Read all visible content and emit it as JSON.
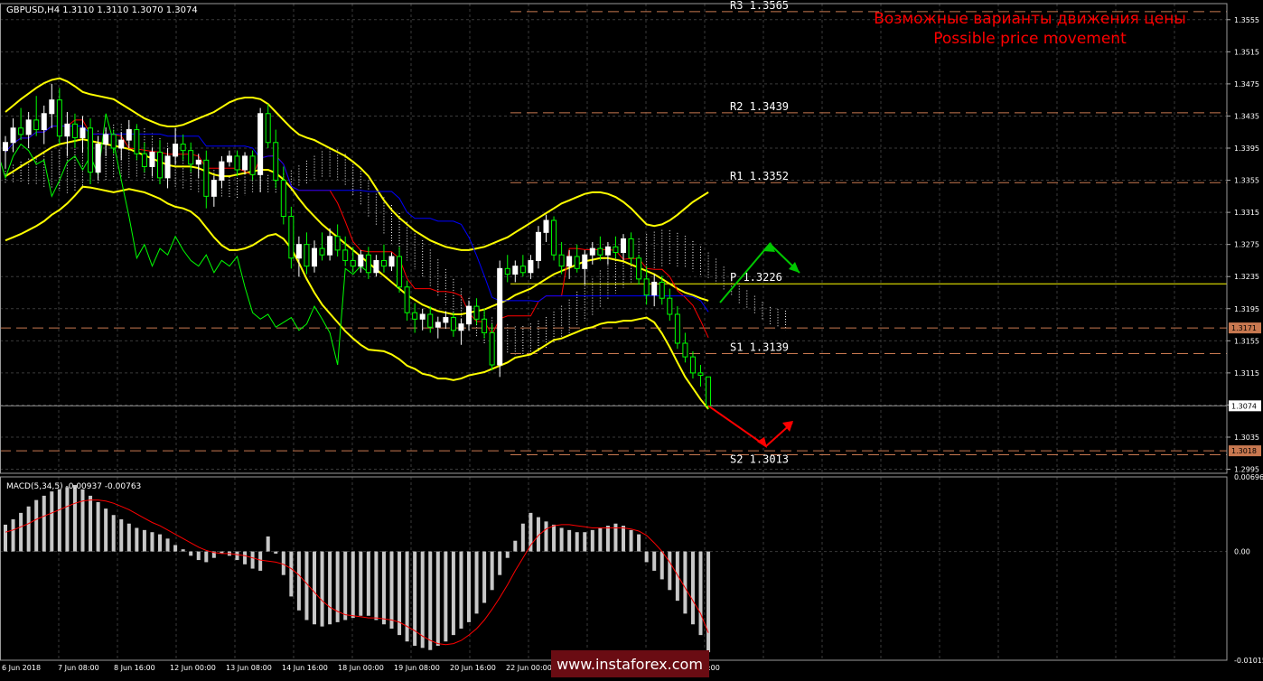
{
  "header": {
    "symbol_line": "GBPUSD,H4  1.3110 1.3110 1.3070 1.3074",
    "title_ru": "Возможные варианты движения цены",
    "title_en": "Possible price movement"
  },
  "macd_header": "MACD(5,34,5) -0.00937 -0.00763",
  "watermark": "www.instaforex.com",
  "colors": {
    "background": "#000000",
    "grid": "#3a3a3a",
    "candle_up": "#ffffff",
    "candle_down": "#00ff00",
    "bollinger": "#ffff00",
    "tenkan": "#ff0000",
    "kijun": "#0000ff",
    "chikou": "#00ff00",
    "kumo_bull": "#ffffff",
    "kumo_bear": "#ff9977",
    "pivot_level": "#c87850",
    "pivot_line": "#ffff00",
    "macd_hist": "#c8c8c8",
    "macd_signal": "#ff0000",
    "title_text": "#ff0000",
    "arrow_up": "#00c800",
    "arrow_down": "#ff0000"
  },
  "chart_data": [
    {
      "type": "candlestick",
      "x_labels": [
        "6 Jun 2018",
        "7 Jun 08:00",
        "8 Jun 16:00",
        "12 Jun 00:00",
        "13 Jun 08:00",
        "14 Jun 16:00",
        "18 Jun 00:00",
        "19 Jun 08:00",
        "20 Jun 16:00",
        "22 Jun 00:00",
        "25 Jun 08:00",
        "26 Jun 16:00",
        "28 Jun 00:00"
      ],
      "y_ticks": [
        "1.3555",
        "1.3515",
        "1.3475",
        "1.3435",
        "1.3395",
        "1.3355",
        "1.3315",
        "1.3275",
        "1.3235",
        "1.3195",
        "1.3155",
        "1.3115",
        "1.3075",
        "1.3035",
        "1.2995"
      ],
      "ylim": [
        1.299,
        1.3575
      ],
      "current_price": "1.3074",
      "price_labels": [
        {
          "value": 1.3171,
          "text": "1.3171"
        },
        {
          "value": 1.3074,
          "text": "1.3074"
        },
        {
          "value": 1.3018,
          "text": "1.3018"
        }
      ],
      "pivot_levels": [
        {
          "name": "R3",
          "value": 1.3565,
          "label": "R3  1.3565"
        },
        {
          "name": "R2",
          "value": 1.3439,
          "label": "R2  1.3439"
        },
        {
          "name": "R1",
          "value": 1.3352,
          "label": "R1  1.3352"
        },
        {
          "name": "P",
          "value": 1.3226,
          "label": "P  1.3226"
        },
        {
          "name": "S1",
          "value": 1.3139,
          "label": "S1  1.3139"
        },
        {
          "name": "S2",
          "value": 1.3013,
          "label": "S2  1.3013"
        }
      ],
      "extra_levels": [
        1.3171,
        1.3018
      ],
      "candles": [
        [
          1.3392,
          1.341,
          1.337,
          1.3402
        ],
        [
          1.3402,
          1.3432,
          1.339,
          1.342
        ],
        [
          1.342,
          1.3445,
          1.3405,
          1.3412
        ],
        [
          1.3412,
          1.344,
          1.3395,
          1.343
        ],
        [
          1.343,
          1.346,
          1.341,
          1.3418
        ],
        [
          1.3418,
          1.3448,
          1.34,
          1.3438
        ],
        [
          1.3438,
          1.3475,
          1.342,
          1.3455
        ],
        [
          1.3455,
          1.347,
          1.34,
          1.341
        ],
        [
          1.341,
          1.344,
          1.3385,
          1.3425
        ],
        [
          1.3425,
          1.3438,
          1.3395,
          1.3408
        ],
        [
          1.3408,
          1.3435,
          1.339,
          1.342
        ],
        [
          1.342,
          1.3432,
          1.335,
          1.3365
        ],
        [
          1.3365,
          1.341,
          1.3355,
          1.34
        ],
        [
          1.34,
          1.342,
          1.3385,
          1.3412
        ],
        [
          1.3412,
          1.3418,
          1.3388,
          1.3395
        ],
        [
          1.3395,
          1.3415,
          1.338,
          1.3405
        ],
        [
          1.3405,
          1.343,
          1.3395,
          1.3418
        ],
        [
          1.3418,
          1.3425,
          1.338,
          1.3388
        ],
        [
          1.3388,
          1.3402,
          1.3365,
          1.3372
        ],
        [
          1.3372,
          1.3395,
          1.336,
          1.339
        ],
        [
          1.339,
          1.3405,
          1.335,
          1.3358
        ],
        [
          1.3358,
          1.3395,
          1.3345,
          1.3385
        ],
        [
          1.3385,
          1.342,
          1.3375,
          1.34
        ],
        [
          1.34,
          1.3412,
          1.338,
          1.3392
        ],
        [
          1.3392,
          1.3402,
          1.3365,
          1.3375
        ],
        [
          1.3375,
          1.3388,
          1.3358,
          1.338
        ],
        [
          1.338,
          1.3392,
          1.332,
          1.3335
        ],
        [
          1.3335,
          1.336,
          1.3322,
          1.3355
        ],
        [
          1.3355,
          1.3385,
          1.3345,
          1.3378
        ],
        [
          1.3378,
          1.3392,
          1.3372,
          1.3385
        ],
        [
          1.3385,
          1.3392,
          1.336,
          1.3368
        ],
        [
          1.3368,
          1.339,
          1.3362,
          1.3385
        ],
        [
          1.3385,
          1.3392,
          1.3355,
          1.3362
        ],
        [
          1.3362,
          1.3445,
          1.334,
          1.3438
        ],
        [
          1.3438,
          1.345,
          1.3395,
          1.3402
        ],
        [
          1.3402,
          1.3418,
          1.3345,
          1.3355
        ],
        [
          1.3355,
          1.3372,
          1.33,
          1.331
        ],
        [
          1.331,
          1.3322,
          1.3245,
          1.3258
        ],
        [
          1.3258,
          1.3285,
          1.3235,
          1.3275
        ],
        [
          1.3275,
          1.329,
          1.3238,
          1.3248
        ],
        [
          1.3248,
          1.328,
          1.324,
          1.327
        ],
        [
          1.327,
          1.329,
          1.3255,
          1.3262
        ],
        [
          1.3262,
          1.3295,
          1.3255,
          1.3285
        ],
        [
          1.3285,
          1.33,
          1.326,
          1.3268
        ],
        [
          1.3268,
          1.3285,
          1.3248,
          1.3255
        ],
        [
          1.3255,
          1.3272,
          1.324,
          1.3248
        ],
        [
          1.3248,
          1.3268,
          1.324,
          1.3262
        ],
        [
          1.3262,
          1.3272,
          1.3232,
          1.324
        ],
        [
          1.324,
          1.3262,
          1.3235,
          1.3255
        ],
        [
          1.3255,
          1.3275,
          1.324,
          1.3248
        ],
        [
          1.3248,
          1.3265,
          1.3242,
          1.326
        ],
        [
          1.326,
          1.3272,
          1.3215,
          1.3222
        ],
        [
          1.3222,
          1.323,
          1.318,
          1.319
        ],
        [
          1.319,
          1.3202,
          1.3165,
          1.3182
        ],
        [
          1.3182,
          1.3195,
          1.3168,
          1.3188
        ],
        [
          1.3188,
          1.3198,
          1.3165,
          1.3172
        ],
        [
          1.3172,
          1.3185,
          1.3158,
          1.3178
        ],
        [
          1.3178,
          1.3192,
          1.317,
          1.3184
        ],
        [
          1.3184,
          1.319,
          1.316,
          1.3168
        ],
        [
          1.3168,
          1.3182,
          1.315,
          1.3176
        ],
        [
          1.3176,
          1.3205,
          1.3168,
          1.3198
        ],
        [
          1.3198,
          1.3208,
          1.3175,
          1.3182
        ],
        [
          1.3182,
          1.3195,
          1.3158,
          1.3165
        ],
        [
          1.3165,
          1.3176,
          1.3118,
          1.3125
        ],
        [
          1.3125,
          1.3255,
          1.311,
          1.3245
        ],
        [
          1.3245,
          1.3262,
          1.3228,
          1.3238
        ],
        [
          1.3238,
          1.3255,
          1.3228,
          1.3248
        ],
        [
          1.3248,
          1.3262,
          1.3235,
          1.324
        ],
        [
          1.324,
          1.3262,
          1.3232,
          1.3255
        ],
        [
          1.3255,
          1.3298,
          1.3245,
          1.329
        ],
        [
          1.329,
          1.3312,
          1.3278,
          1.3305
        ],
        [
          1.3305,
          1.331,
          1.3255,
          1.3262
        ],
        [
          1.3262,
          1.3278,
          1.3238,
          1.3248
        ],
        [
          1.3248,
          1.3268,
          1.3232,
          1.326
        ],
        [
          1.326,
          1.3275,
          1.324,
          1.3245
        ],
        [
          1.3245,
          1.3268,
          1.3225,
          1.3262
        ],
        [
          1.3262,
          1.3278,
          1.325,
          1.327
        ],
        [
          1.327,
          1.3285,
          1.3255,
          1.3262
        ],
        [
          1.3262,
          1.3278,
          1.325,
          1.3272
        ],
        [
          1.3272,
          1.3285,
          1.3258,
          1.3265
        ],
        [
          1.3265,
          1.3288,
          1.3255,
          1.3282
        ],
        [
          1.3282,
          1.329,
          1.325,
          1.3258
        ],
        [
          1.3258,
          1.3262,
          1.3225,
          1.3232
        ],
        [
          1.3232,
          1.3248,
          1.32,
          1.3212
        ],
        [
          1.3212,
          1.3238,
          1.3198,
          1.3228
        ],
        [
          1.3228,
          1.3236,
          1.32,
          1.3208
        ],
        [
          1.3208,
          1.322,
          1.318,
          1.3188
        ],
        [
          1.3188,
          1.3198,
          1.3145,
          1.3152
        ],
        [
          1.3152,
          1.3165,
          1.3128,
          1.3135
        ],
        [
          1.3135,
          1.3142,
          1.3108,
          1.3115
        ],
        [
          1.3115,
          1.3125,
          1.3098,
          1.3112
        ],
        [
          1.311,
          1.311,
          1.307,
          1.3074
        ]
      ],
      "indicators": {
        "bollinger_upper": [
          1.344,
          1.3448,
          1.3456,
          1.3463,
          1.347,
          1.3476,
          1.348,
          1.3482,
          1.3478,
          1.3472,
          1.3465,
          1.3462,
          1.346,
          1.3458,
          1.3456,
          1.345,
          1.3444,
          1.3438,
          1.3432,
          1.3428,
          1.3424,
          1.3422,
          1.3422,
          1.3424,
          1.3428,
          1.3432,
          1.3436,
          1.344,
          1.3446,
          1.3452,
          1.3456,
          1.3458,
          1.3458,
          1.3456,
          1.345,
          1.344,
          1.343,
          1.342,
          1.3412,
          1.3408,
          1.3405,
          1.34,
          1.3395,
          1.339,
          1.3385,
          1.3378,
          1.337,
          1.336,
          1.3345,
          1.333,
          1.3318,
          1.3308,
          1.33,
          1.3292,
          1.3286,
          1.328,
          1.3276,
          1.3272,
          1.327,
          1.3268,
          1.3268,
          1.327,
          1.3272,
          1.3276,
          1.328,
          1.3284,
          1.329,
          1.3296,
          1.3302,
          1.3308,
          1.3314,
          1.332,
          1.3326,
          1.333,
          1.3334,
          1.3338,
          1.334,
          1.334,
          1.3338,
          1.3334,
          1.3328,
          1.332,
          1.331,
          1.33,
          1.3298,
          1.33,
          1.3305,
          1.3312,
          1.332,
          1.3328,
          1.3334,
          1.334
        ],
        "bollinger_mid": [
          1.336,
          1.3366,
          1.3372,
          1.3378,
          1.3384,
          1.339,
          1.3396,
          1.34,
          1.3402,
          1.3404,
          1.3406,
          1.3404,
          1.3402,
          1.34,
          1.3398,
          1.3396,
          1.3394,
          1.339,
          1.3386,
          1.3382,
          1.3378,
          1.3374,
          1.3372,
          1.3372,
          1.3372,
          1.337,
          1.3366,
          1.3362,
          1.336,
          1.336,
          1.3362,
          1.3364,
          1.3366,
          1.3368,
          1.3368,
          1.3364,
          1.3356,
          1.3345,
          1.3332,
          1.332,
          1.331,
          1.33,
          1.3292,
          1.3284,
          1.3276,
          1.3268,
          1.326,
          1.3252,
          1.3244,
          1.3236,
          1.3228,
          1.322,
          1.3212,
          1.3206,
          1.32,
          1.3196,
          1.3192,
          1.319,
          1.3188,
          1.3188,
          1.319,
          1.3192,
          1.3194,
          1.3198,
          1.3202,
          1.3206,
          1.3212,
          1.3216,
          1.322,
          1.3226,
          1.3232,
          1.3238,
          1.3242,
          1.3246,
          1.325,
          1.3254,
          1.3256,
          1.3258,
          1.3258,
          1.3256,
          1.3254,
          1.325,
          1.3246,
          1.3242,
          1.3238,
          1.3232,
          1.3226,
          1.322,
          1.3215,
          1.3212,
          1.3208,
          1.3205
        ],
        "bollinger_lower": [
          1.328,
          1.3284,
          1.3288,
          1.3293,
          1.3298,
          1.3304,
          1.3312,
          1.3318,
          1.3326,
          1.3336,
          1.3347,
          1.3346,
          1.3344,
          1.3342,
          1.334,
          1.3342,
          1.3344,
          1.3342,
          1.334,
          1.3336,
          1.3332,
          1.3326,
          1.3322,
          1.332,
          1.3316,
          1.3308,
          1.3296,
          1.3284,
          1.3274,
          1.3268,
          1.3268,
          1.327,
          1.3274,
          1.328,
          1.3286,
          1.3288,
          1.3282,
          1.327,
          1.3252,
          1.3232,
          1.3215,
          1.32,
          1.3189,
          1.3178,
          1.3167,
          1.3158,
          1.315,
          1.3144,
          1.3143,
          1.3142,
          1.3138,
          1.3132,
          1.3124,
          1.312,
          1.3114,
          1.3112,
          1.3108,
          1.3108,
          1.3106,
          1.3108,
          1.3112,
          1.3114,
          1.3116,
          1.312,
          1.3124,
          1.3128,
          1.3134,
          1.3136,
          1.3138,
          1.3144,
          1.315,
          1.3156,
          1.3158,
          1.3162,
          1.3166,
          1.317,
          1.3172,
          1.3176,
          1.3178,
          1.3178,
          1.318,
          1.318,
          1.3182,
          1.3184,
          1.3178,
          1.3164,
          1.3147,
          1.3128,
          1.311,
          1.3096,
          1.3082,
          1.307
        ]
      }
    },
    {
      "type": "bar",
      "title": "MACD(5,34,5) -0.00937 -0.00763",
      "y_ticks": [
        "0.00696",
        "0.00",
        "-0.01015"
      ],
      "ylim": [
        -0.01015,
        0.00696
      ],
      "histogram": [
        0.0025,
        0.003,
        0.0036,
        0.0042,
        0.0048,
        0.0052,
        0.0056,
        0.0058,
        0.006,
        0.0062,
        0.0058,
        0.0052,
        0.0046,
        0.004,
        0.0034,
        0.003,
        0.0026,
        0.0022,
        0.002,
        0.0018,
        0.0016,
        0.0012,
        0.0006,
        0.0002,
        -0.0004,
        -0.0008,
        -0.001,
        -0.0006,
        -0.0002,
        -0.0004,
        -0.0008,
        -0.0012,
        -0.0016,
        -0.0018,
        0.0014,
        -0.0002,
        -0.0022,
        -0.0042,
        -0.0055,
        -0.0064,
        -0.0068,
        -0.007,
        -0.0068,
        -0.0066,
        -0.0064,
        -0.0062,
        -0.006,
        -0.006,
        -0.0064,
        -0.0068,
        -0.0072,
        -0.0078,
        -0.0084,
        -0.0088,
        -0.009,
        -0.0092,
        -0.0088,
        -0.0084,
        -0.0078,
        -0.0072,
        -0.0066,
        -0.0058,
        -0.0048,
        -0.0036,
        -0.0022,
        -0.0006,
        0.001,
        0.0026,
        0.0036,
        0.0032,
        0.0028,
        0.0025,
        0.0022,
        0.002,
        0.0018,
        0.0018,
        0.002,
        0.0022,
        0.0024,
        0.0026,
        0.0024,
        0.002,
        0.0016,
        -0.001,
        -0.0018,
        -0.0026,
        -0.0036,
        -0.0046,
        -0.0058,
        -0.0068,
        -0.0078,
        -0.0094
      ],
      "signal": [
        0.0018,
        0.002,
        0.0023,
        0.0026,
        0.003,
        0.0033,
        0.0036,
        0.0039,
        0.0042,
        0.0045,
        0.0047,
        0.0048,
        0.0048,
        0.0047,
        0.0045,
        0.0042,
        0.0039,
        0.0035,
        0.0031,
        0.0027,
        0.0024,
        0.002,
        0.0016,
        0.0012,
        0.0008,
        0.0004,
        0.0001,
        -0.0001,
        -0.0002,
        -0.0002,
        -0.0003,
        -0.0004,
        -0.0006,
        -0.0008,
        -0.0009,
        -0.001,
        -0.0012,
        -0.0016,
        -0.0022,
        -0.003,
        -0.0038,
        -0.0046,
        -0.0052,
        -0.0056,
        -0.0059,
        -0.006,
        -0.0061,
        -0.0062,
        -0.0062,
        -0.0063,
        -0.0064,
        -0.0066,
        -0.007,
        -0.0074,
        -0.0079,
        -0.0083,
        -0.0086,
        -0.0087,
        -0.0086,
        -0.0083,
        -0.0078,
        -0.0072,
        -0.0064,
        -0.0054,
        -0.0043,
        -0.0031,
        -0.0018,
        -0.0006,
        0.0006,
        0.0015,
        0.0021,
        0.0024,
        0.0025,
        0.0025,
        0.0024,
        0.0023,
        0.0022,
        0.0022,
        0.0022,
        0.0022,
        0.0022,
        0.0021,
        0.0019,
        0.0015,
        0.0008,
        0.0,
        -0.001,
        -0.0022,
        -0.0034,
        -0.0046,
        -0.0058,
        -0.0076
      ]
    }
  ]
}
